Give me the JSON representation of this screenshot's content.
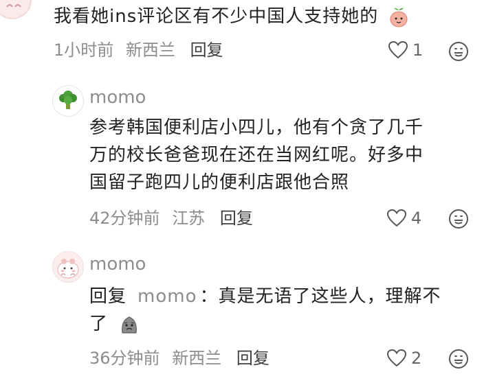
{
  "comments": [
    {
      "text": "我看她ins评论区有不少中国人支持她的",
      "time": "1小时前",
      "location": "新西兰",
      "reply_label": "回复",
      "likes": "1"
    },
    {
      "username": "momo",
      "text": "参考韩国便利店小四儿，他有个贪了几千万的校长爸爸现在还在当网红呢。好多中国留子跑四儿的便利店跟他合照",
      "line1": "参考韩国便利店小四儿，他有个贪了几千",
      "line2": "万的校长爸爸现在还在当网红呢。好多中",
      "line3": "国留子跑四儿的便利店跟他合照",
      "time": "42分钟前",
      "location": "江苏",
      "reply_label": "回复",
      "likes": "4"
    },
    {
      "username": "momo",
      "reply_prefix": "回复",
      "reply_to": "momo",
      "text_line1": "：真是无语了这些人，理解不",
      "text_line2": "了",
      "time": "36分钟前",
      "location": "新西兰",
      "reply_label": "回复",
      "likes": "2"
    }
  ],
  "icons": {
    "like": "heart-outline-icon",
    "emoji_reaction": "smiley-outline-icon",
    "peach": "peach-emoji",
    "broccoli_avatar": "broccoli-avatar",
    "pink_avatar": "pink-cartoon-avatar",
    "sad_emoji": "grey-blob-emoji"
  },
  "colors": {
    "meta": "#8c8c8c",
    "text": "#222222",
    "icon": "#555555"
  }
}
